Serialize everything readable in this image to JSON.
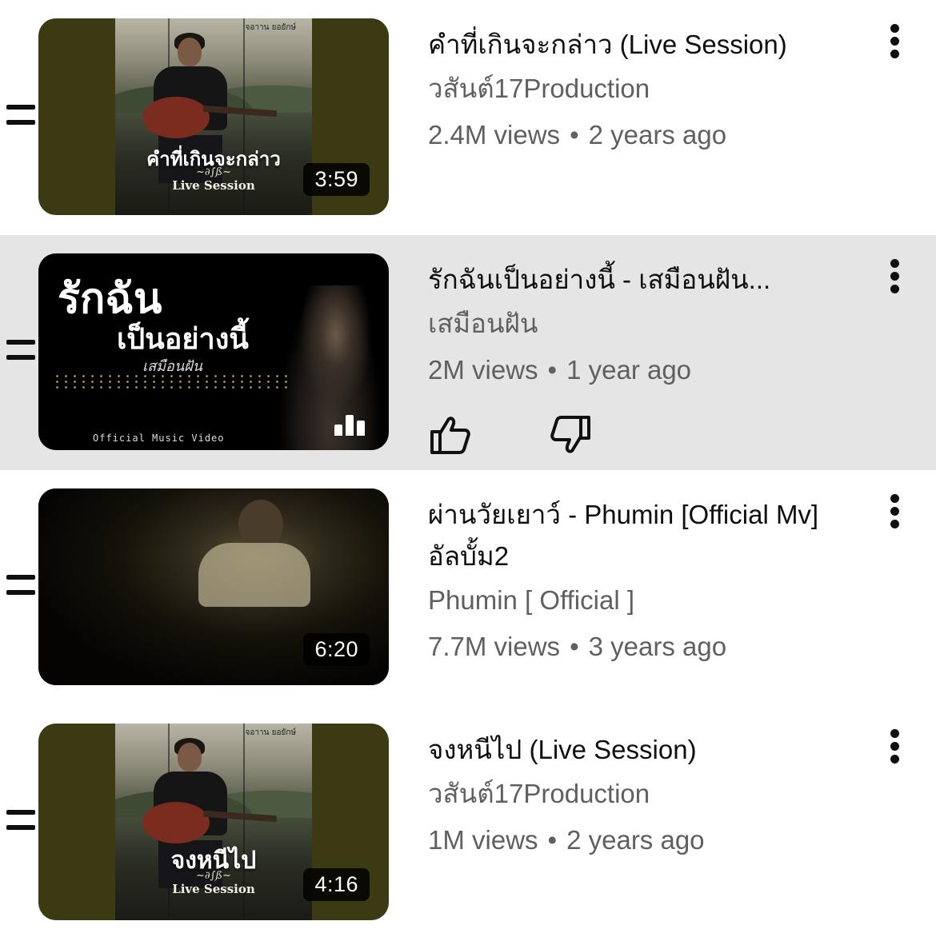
{
  "videos": [
    {
      "title": "คำที่เกินจะกล่าว (Live Session)",
      "channel": "วสันต์17Production",
      "views": "2.4M views",
      "age": "2 years ago",
      "duration": "3:59",
      "thumb_text": "คำที่เกินจะกล่าว",
      "thumb_sub": "Live Session",
      "thumb_brand": "จอาาน ยอยักษ์"
    },
    {
      "title": "รักฉันเป็นอย่างนี้ - เสมือนฝัน...",
      "channel": "เสมือนฝัน",
      "views": "2M views",
      "age": "1 year ago",
      "thumb_text_1": "รักฉัน",
      "thumb_text_2": "เป็นอย่างนี้",
      "thumb_text_3": "เสมือนฝัน",
      "thumb_sub": "Official Music Video",
      "playing_icon": "equalizer-icon",
      "actions": [
        "thumbs-up-icon",
        "thumbs-down-icon"
      ]
    },
    {
      "title_line1": "ผ่านวัยเยาว์ - Phumin [Official Mv]",
      "title_line2": "อัลบั้ม2",
      "channel": "Phumin [ Official ]",
      "views": "7.7M views",
      "age": "3 years ago",
      "duration": "6:20"
    },
    {
      "title": "จงหนีไป (Live Session)",
      "channel": "วสันต์17Production",
      "views": "1M views",
      "age": "2 years ago",
      "duration": "4:16",
      "thumb_text": "จงหนีไป",
      "thumb_sub": "Live Session",
      "thumb_brand": "จอาาน ยอยักษ์"
    }
  ],
  "separator": "•",
  "active_row_color": "#e5e5e5"
}
